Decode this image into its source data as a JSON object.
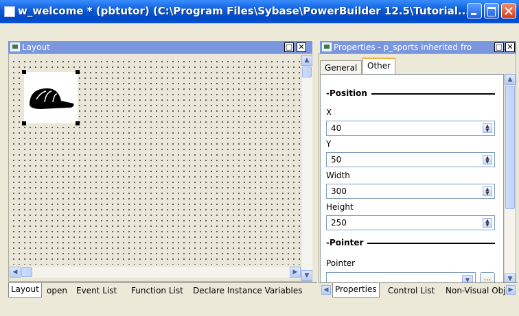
{
  "window": {
    "title": "w_welcome * (pbtutor) (C:\\Program Files\\Sybase\\PowerBuilder 12.5\\Tutorial...",
    "minimize_label": "minimize",
    "maximize_label": "maximize",
    "close_label": "close"
  },
  "layout_pane": {
    "title": "Layout",
    "max_glyph": "□",
    "close_glyph": "✕",
    "picture_icon": "baseball-cap-icon"
  },
  "layout_tabs": [
    "Layout",
    "open",
    "Event List",
    "Function List",
    "Declare Instance Variables"
  ],
  "properties_pane": {
    "title": "Properties - p_sports  inherited  fro",
    "tabs": [
      "General",
      "Other"
    ],
    "active_tab": "Other",
    "position_section": "Position",
    "x_label": "X",
    "x_value": "40",
    "y_label": "Y",
    "y_value": "50",
    "width_label": "Width",
    "width_value": "300",
    "height_label": "Height",
    "height_value": "250",
    "pointer_section": "Pointer",
    "pointer_label": "Pointer",
    "pointer_value": "",
    "ellipsis_label": "..."
  },
  "properties_tabs": [
    "Properties",
    "Control List",
    "Non-Visual Obj"
  ],
  "colors": {
    "title_bar": "#0a54d4",
    "pane_header": "#7a96df",
    "active_tab_accent": "#f3b33a"
  }
}
